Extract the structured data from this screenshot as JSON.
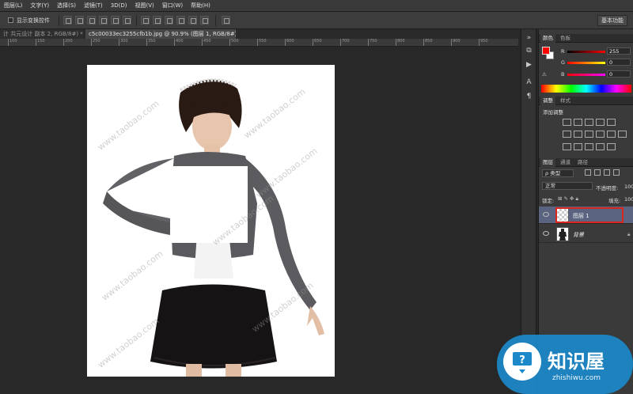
{
  "menubar": {
    "items": [
      "图层(L)",
      "文字(Y)",
      "选择(S)",
      "滤镜(T)",
      "3D(D)",
      "视图(V)",
      "窗口(W)",
      "帮助(H)"
    ]
  },
  "options": {
    "show_transform_label": "显示变换控件",
    "workspace_label": "基本功能"
  },
  "tabs": [
    {
      "label": "计 共元设计 副本 2, RGB/8#) *",
      "close": "×"
    },
    {
      "label": "c5c00033ec3255cfb1b.jpg @ 90.9% (图层 1, RGB/8#) *",
      "close": "×"
    }
  ],
  "ruler": {
    "ticks": [
      "100",
      "150",
      "200",
      "250",
      "300",
      "350",
      "400",
      "450",
      "500",
      "550",
      "600",
      "650",
      "700",
      "750",
      "800",
      "850",
      "900",
      "950"
    ]
  },
  "color_panel": {
    "tabs": [
      "颜色",
      "色板"
    ],
    "channels": [
      {
        "label": "R",
        "value": "255"
      },
      {
        "label": "G",
        "value": "0"
      },
      {
        "label": "B",
        "value": "0"
      }
    ],
    "foreground": "#ff0000",
    "background": "#ffffff"
  },
  "adjust_panel": {
    "tabs": [
      "调整",
      "样式"
    ],
    "title": "添加调整"
  },
  "layers_panel": {
    "tabs": [
      "图层",
      "通道",
      "路径"
    ],
    "filter_label": "ρ 类型",
    "blend_mode": "正常",
    "opacity_label": "不透明度:",
    "opacity_value": "100",
    "lock_label": "锁定:",
    "fill_label": "填充:",
    "fill_value": "100",
    "layers": [
      {
        "name": "图层 1",
        "selected": true
      },
      {
        "name": "背景",
        "selected": false
      }
    ]
  },
  "canvas": {
    "watermark": "www.taobao.com"
  },
  "brand": {
    "name": "知识屋",
    "url": "zhishiwu.com"
  }
}
